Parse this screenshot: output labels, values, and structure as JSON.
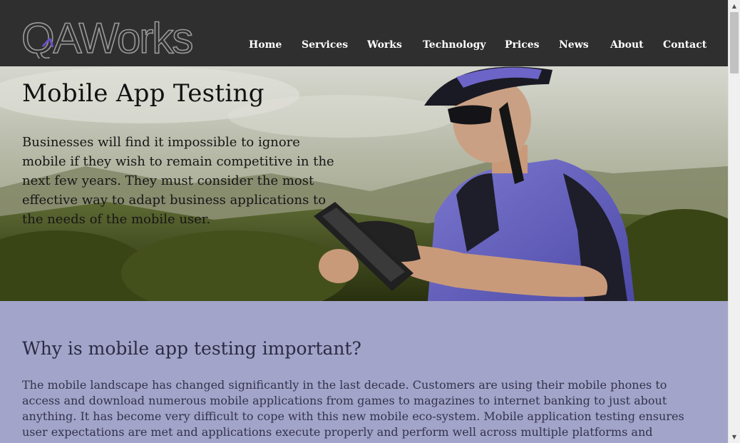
{
  "brand": {
    "logo_text": "QAWorks"
  },
  "nav": {
    "items": [
      {
        "label": "Home"
      },
      {
        "label": "Services"
      },
      {
        "label": "Works"
      },
      {
        "label": "Technology"
      },
      {
        "label": "Prices"
      },
      {
        "label": "News"
      },
      {
        "label": "About"
      },
      {
        "label": "Contact"
      }
    ]
  },
  "hero": {
    "title": "Mobile App Testing",
    "text": "Businesses will find it impossible to ignore mobile if they wish to remain competitive in the next few years. They must consider the most effective way to adapt business applications to the needs of the mobile user."
  },
  "section": {
    "title": "Why is mobile app testing important?",
    "text": "The mobile landscape has changed significantly in the last decade. Customers are using their mobile phones to access and download numerous mobile applications from games to magazines to internet banking to just about anything. It has become very difficult to cope with this new mobile eco-system. Mobile application testing ensures user expectations are met and applications execute properly and perform well across multiple platforms and"
  },
  "scrollbar": {
    "up_icon": "triangle-up-icon",
    "down_icon": "triangle-down-icon"
  },
  "colors": {
    "header_bg": "#2f2f2f",
    "content_bg": "#a3a4c9",
    "logo_grey": "#9a9a9a",
    "logo_purple": "#6a4fc8"
  }
}
